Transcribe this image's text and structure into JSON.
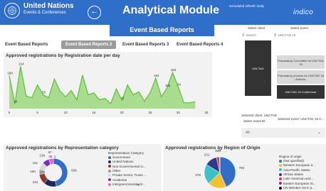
{
  "header": {
    "org_name": "United Nations",
    "org_sub": "Events & Conferences",
    "app_title": "Analytical Module",
    "refresh_note": "Scheduled refresh: Daily",
    "brand": "indico"
  },
  "page_title": "Event Based Reports",
  "tabs": [
    {
      "label": "Event Based Reports",
      "active": false
    },
    {
      "label": "Event Based Reports 2",
      "active": true
    },
    {
      "label": "Event Based Reports 3",
      "active": false
    },
    {
      "label": "Event Based Reports 4",
      "active": false
    }
  ],
  "line_panel": {
    "title": "Approved registrations by Registration date per day",
    "chart_data": {
      "type": "area",
      "x_ticks": [
        "0",
        "5",
        "10",
        "15",
        "20",
        "25",
        "30",
        "35"
      ],
      "x": [
        0,
        1,
        2,
        3,
        4,
        5,
        6,
        7,
        8,
        9,
        10,
        11,
        12,
        13,
        14,
        15,
        16,
        17,
        18,
        19,
        20,
        21,
        22,
        23,
        24,
        25,
        26,
        27,
        28,
        29,
        30,
        31,
        32,
        33
      ],
      "values": [
        168,
        24,
        214,
        64,
        55,
        120,
        70,
        55,
        150,
        90,
        60,
        92,
        45,
        170,
        70,
        80,
        45,
        52,
        25,
        100,
        41,
        120,
        70,
        85,
        38,
        80,
        154,
        60,
        105,
        183,
        110,
        30,
        30,
        35
      ],
      "data_labels": [
        {
          "x": 0,
          "text": "168"
        },
        {
          "x": 2,
          "text": "214"
        },
        {
          "x": 1,
          "text": "24"
        },
        {
          "x": 6,
          "text": "55"
        },
        {
          "x": 20,
          "text": "41"
        },
        {
          "x": 26,
          "text": "154"
        },
        {
          "x": 29,
          "text": "183"
        },
        {
          "x": 28,
          "text": "105"
        },
        {
          "x": 30,
          "text": "34"
        }
      ],
      "color": "#5cbf3a",
      "fill": "#a9dc8f"
    }
  },
  "slicers": {
    "client_label": "Select client",
    "event_label": "Select event",
    "client_search": "Search",
    "event_search": "UNCTAD 15",
    "client_selected_item": "UNCTAD",
    "event_items": [
      "Preparatory Committee for UNCTAD 15",
      "Preparatory process for UNCTAD 15 - Antecia...",
      "UNCTAD 15 Conference"
    ],
    "selected_client": "Selected client: UNCTAD",
    "selected_event": "Selected event: UNCTAD 15 C...",
    "event_id_label": "Select event ID",
    "event_id_value": "All"
  },
  "donut_panel": {
    "title": "Approved registrations by Representation category",
    "legend_title": "Representation Category",
    "chart_data": {
      "type": "pie",
      "categories": [
        "Government",
        "United Nations",
        "Non-Governmental O...",
        "Other",
        "Private Sector, Trusts ...",
        "Academia",
        "Intergovernmental Or..."
      ],
      "values": [
        839,
        266,
        210,
        100,
        151,
        139,
        97
      ],
      "extra_labels": [
        "25",
        "1"
      ],
      "colors": [
        "#2f6fc9",
        "#1b2a5c",
        "#8b3a2f",
        "#9a9a9a",
        "#d9d9d9",
        "#7b2fbe",
        "#e06cc4"
      ]
    }
  },
  "pie_panel": {
    "title": "Approved registrations by Region of Origin",
    "legend_title": "Region of origin",
    "chart_data": {
      "type": "pie",
      "categories": [
        "(Not specified)",
        "Western European a...",
        "Asia-Pacific States",
        "African States",
        "Latin American and ...",
        "Eastern European St...",
        "UN Member not in a..."
      ],
      "values": [
        793,
        355,
        378,
        231,
        60,
        8,
        1
      ],
      "colors": [
        "#2f6fc9",
        "#f2c230",
        "#3cc1c9",
        "#2e3a8c",
        "#e83e3e",
        "#7b2fbe",
        "#111111"
      ]
    }
  }
}
